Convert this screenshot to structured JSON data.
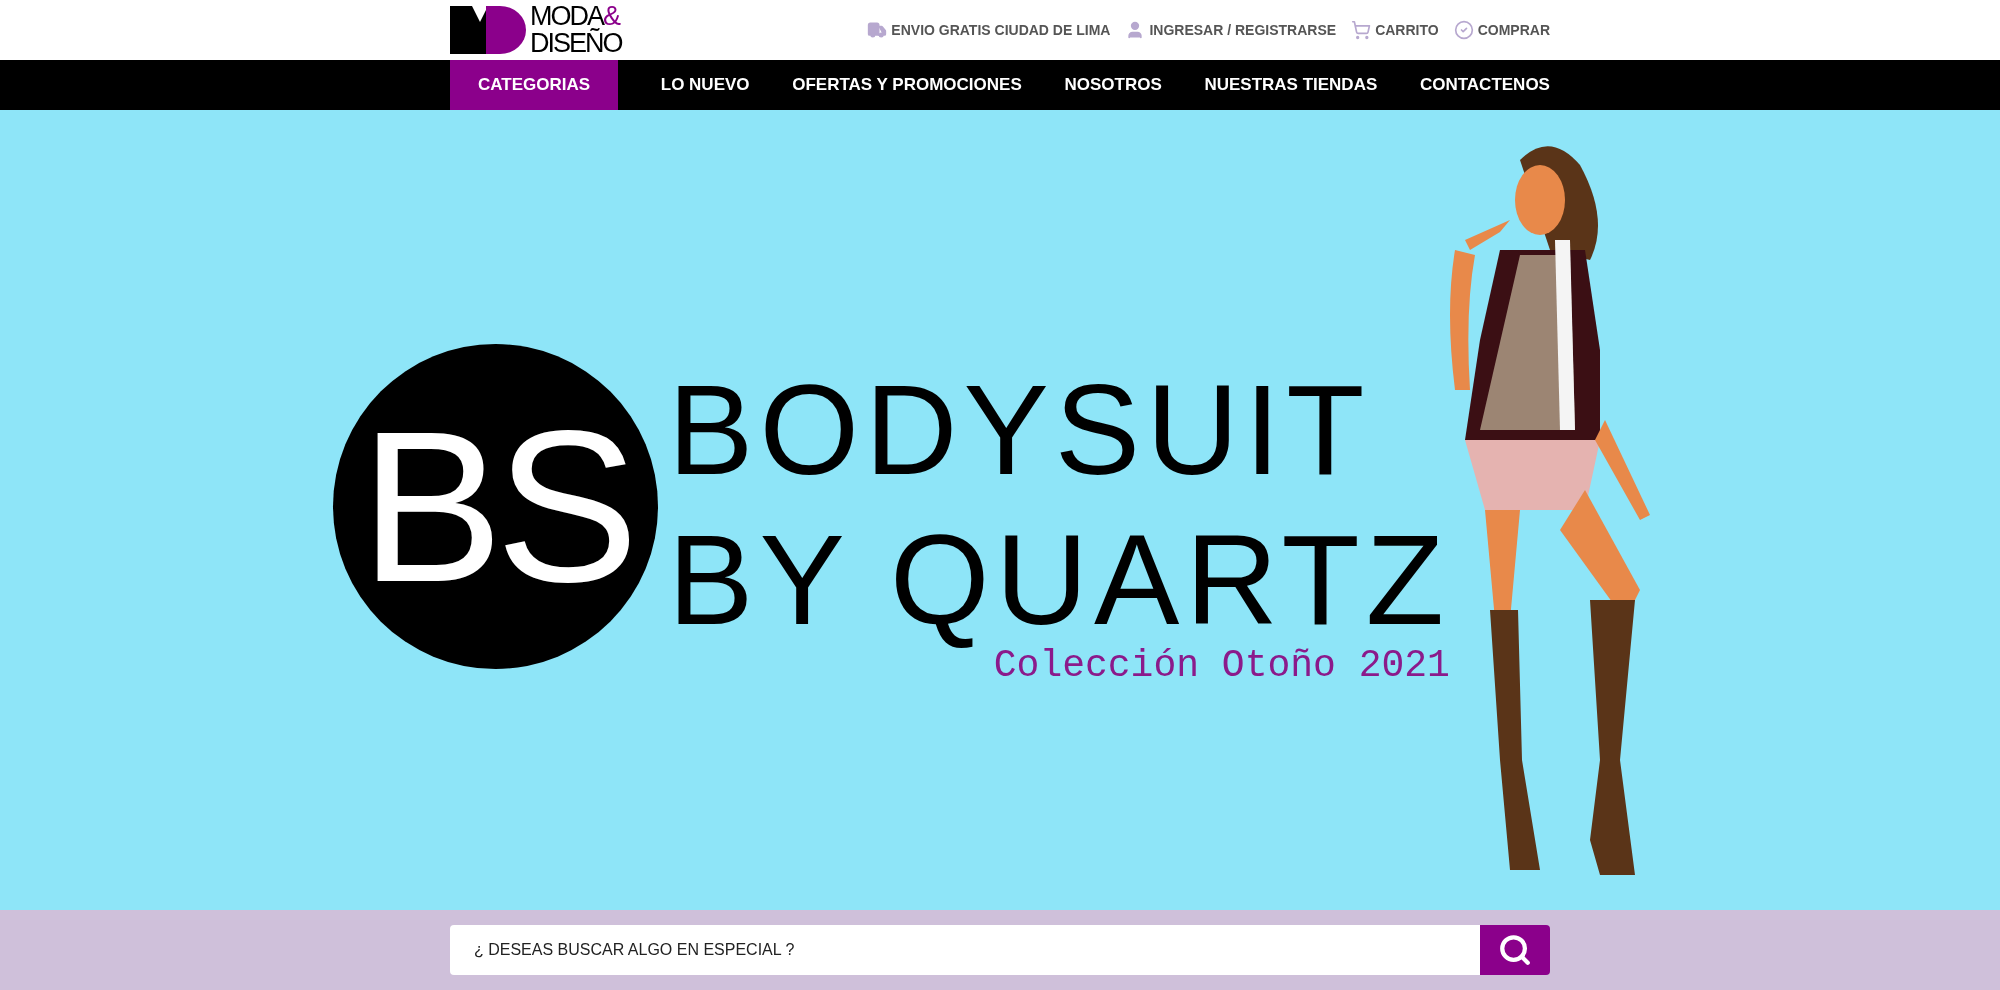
{
  "logo": {
    "top": "MODA",
    "ampersand": "&",
    "bottom": "DISEÑO"
  },
  "top_links": [
    {
      "kind": "truck",
      "label": "ENVIO GRATIS CIUDAD DE LIMA"
    },
    {
      "kind": "user",
      "label": "INGRESAR / REGISTRARSE"
    },
    {
      "kind": "cart",
      "label": "CARRITO"
    },
    {
      "kind": "check",
      "label": "COMPRAR"
    }
  ],
  "nav": [
    {
      "label": "CATEGORIAS",
      "selected": true
    },
    {
      "label": "LO NUEVO",
      "selected": false
    },
    {
      "label": "OFERTAS Y PROMOCIONES",
      "selected": false
    },
    {
      "label": "NOSOTROS",
      "selected": false
    },
    {
      "label": "NUESTRAS TIENDAS",
      "selected": false
    },
    {
      "label": "CONTACTENOS",
      "selected": false
    }
  ],
  "banner": {
    "badge": "BS",
    "title_lines": [
      "BODYSUIT",
      "BY QUARTZ"
    ],
    "subtitle": "Colección Otoño 2021"
  },
  "search": {
    "placeholder": "¿ DESEAS BUSCAR ALGO EN ESPECIAL ?"
  }
}
